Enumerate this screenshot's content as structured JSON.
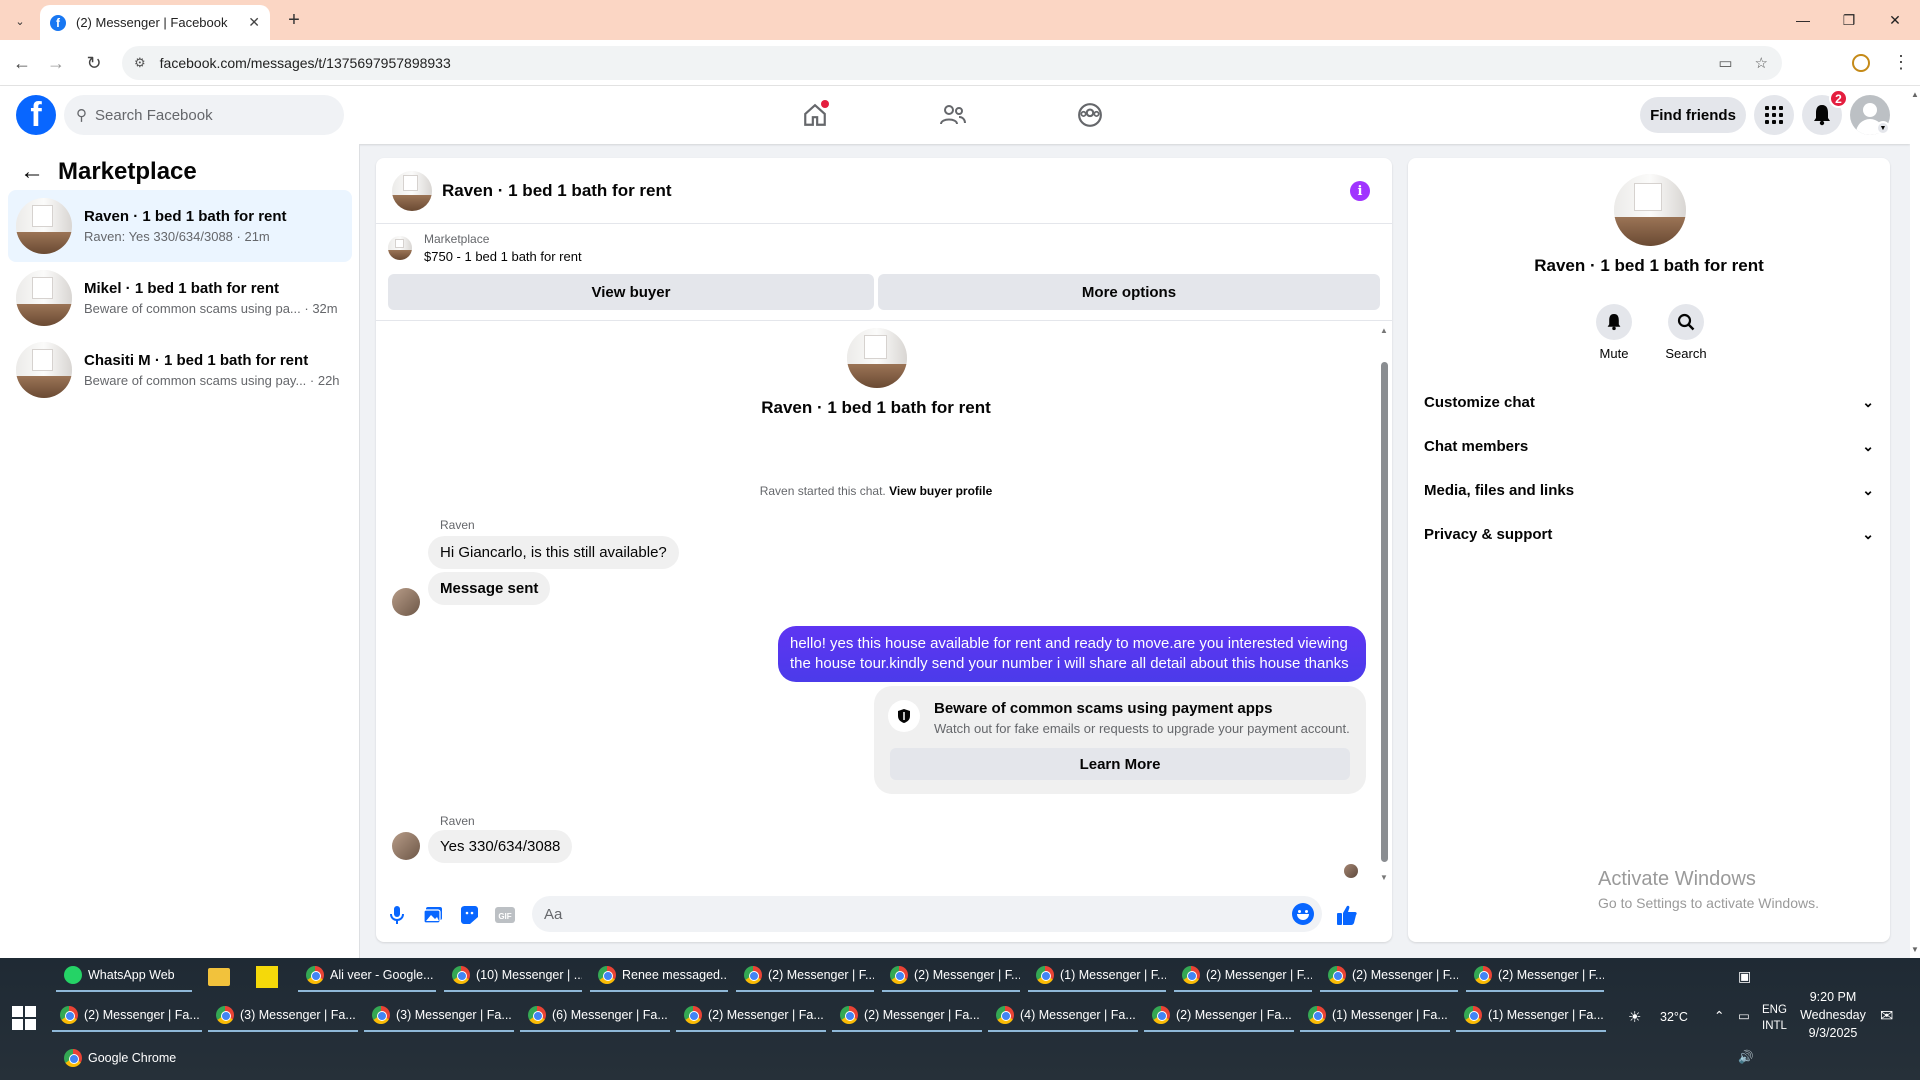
{
  "browser": {
    "tab_title": "(2) Messenger | Facebook",
    "url": "facebook.com/messages/t/1375697957898933"
  },
  "fb": {
    "search_placeholder": "Search Facebook",
    "find_friends": "Find friends",
    "notif_count": "2"
  },
  "sidebar": {
    "title": "Marketplace",
    "conversations": [
      {
        "title": "Raven · 1 bed 1 bath for rent",
        "preview": "Raven: Yes 330/634/3088 · 21m"
      },
      {
        "title": "Mikel · 1 bed 1 bath for rent",
        "preview": "Beware of common scams using pa... · 32m"
      },
      {
        "title": "Chasiti M · 1 bed 1 bath for rent",
        "preview": "Beware of common scams using pay... · 22h"
      }
    ]
  },
  "chat": {
    "title": "Raven · 1 bed 1 bath for rent",
    "banner_label": "Marketplace",
    "banner_listing": "$750 - 1 bed 1 bath for rent",
    "view_buyer": "View buyer",
    "more_options": "More options",
    "intro_title": "Raven · 1 bed 1 bath for rent",
    "system_msg": "Raven started this chat.",
    "view_buyer_profile": "View buyer profile",
    "sender1": "Raven",
    "msg1": "Hi Giancarlo, is this still available?",
    "msg2": "Message sent",
    "outgoing": "hello! yes this house available for rent and ready to move.are you interested viewing the house tour.kindly send your number i will share all detail about this house thanks",
    "scam_title": "Beware of common scams using payment apps",
    "scam_desc": "Watch out for fake emails or requests to upgrade your payment account.",
    "learn_more": "Learn More",
    "sender2": "Raven",
    "msg3": "Yes 330/634/3088",
    "composer_placeholder": "Aa"
  },
  "info": {
    "title": "Raven · 1 bed 1 bath for rent",
    "mute": "Mute",
    "search": "Search",
    "sections": [
      "Customize chat",
      "Chat members",
      "Media, files and links",
      "Privacy & support"
    ]
  },
  "watermark": {
    "line1": "Activate Windows",
    "line2": "Go to Settings to activate Windows."
  },
  "taskbar": {
    "row1": [
      "WhatsApp Web",
      "Ali veer - Google...",
      "(10) Messenger | ...",
      "Renee messaged...",
      "(2) Messenger | F...",
      "(2) Messenger | F...",
      "(1) Messenger | F...",
      "(2) Messenger | F...",
      "(2) Messenger | F...",
      "(2) Messenger | F..."
    ],
    "row2": [
      "(2) Messenger | Fa...",
      "(3) Messenger | Fa...",
      "(3) Messenger | Fa...",
      "(6) Messenger | Fa...",
      "(2) Messenger | Fa...",
      "(2) Messenger | Fa...",
      "(4) Messenger | Fa...",
      "(2) Messenger | Fa...",
      "(1) Messenger | Fa...",
      "(1) Messenger | Fa..."
    ],
    "row3": [
      "Google Chrome"
    ],
    "weather": "32°C",
    "lang1": "ENG",
    "lang2": "INTL",
    "time": "9:20 PM",
    "day": "Wednesday",
    "date": "9/3/2025"
  }
}
